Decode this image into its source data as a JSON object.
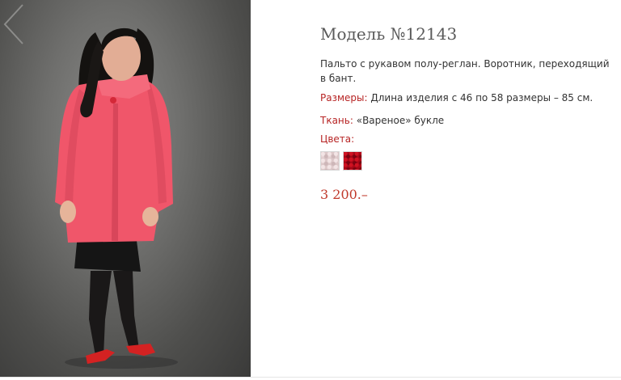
{
  "product": {
    "title": "Модель №12143",
    "description": "Пальто с рукавом полу-реглан. Воротник, переходящий в бант.",
    "sizes_label": "Размеры:",
    "sizes_value": " Длина изделия с 46 по 58 размеры – 85 см.",
    "fabric_label": "Ткань:",
    "fabric_value": " «Вареное» букле",
    "colors_label": "Цвета:",
    "colors": [
      {
        "name": "beige-boucle",
        "hex": "#dcc7c8"
      },
      {
        "name": "red-boucle",
        "hex": "#a80818"
      }
    ],
    "price": "3 200.–"
  },
  "theme": {
    "accent": "#b72424",
    "coat_color": "#f0566a",
    "background_gray": "#6f6f6d"
  }
}
